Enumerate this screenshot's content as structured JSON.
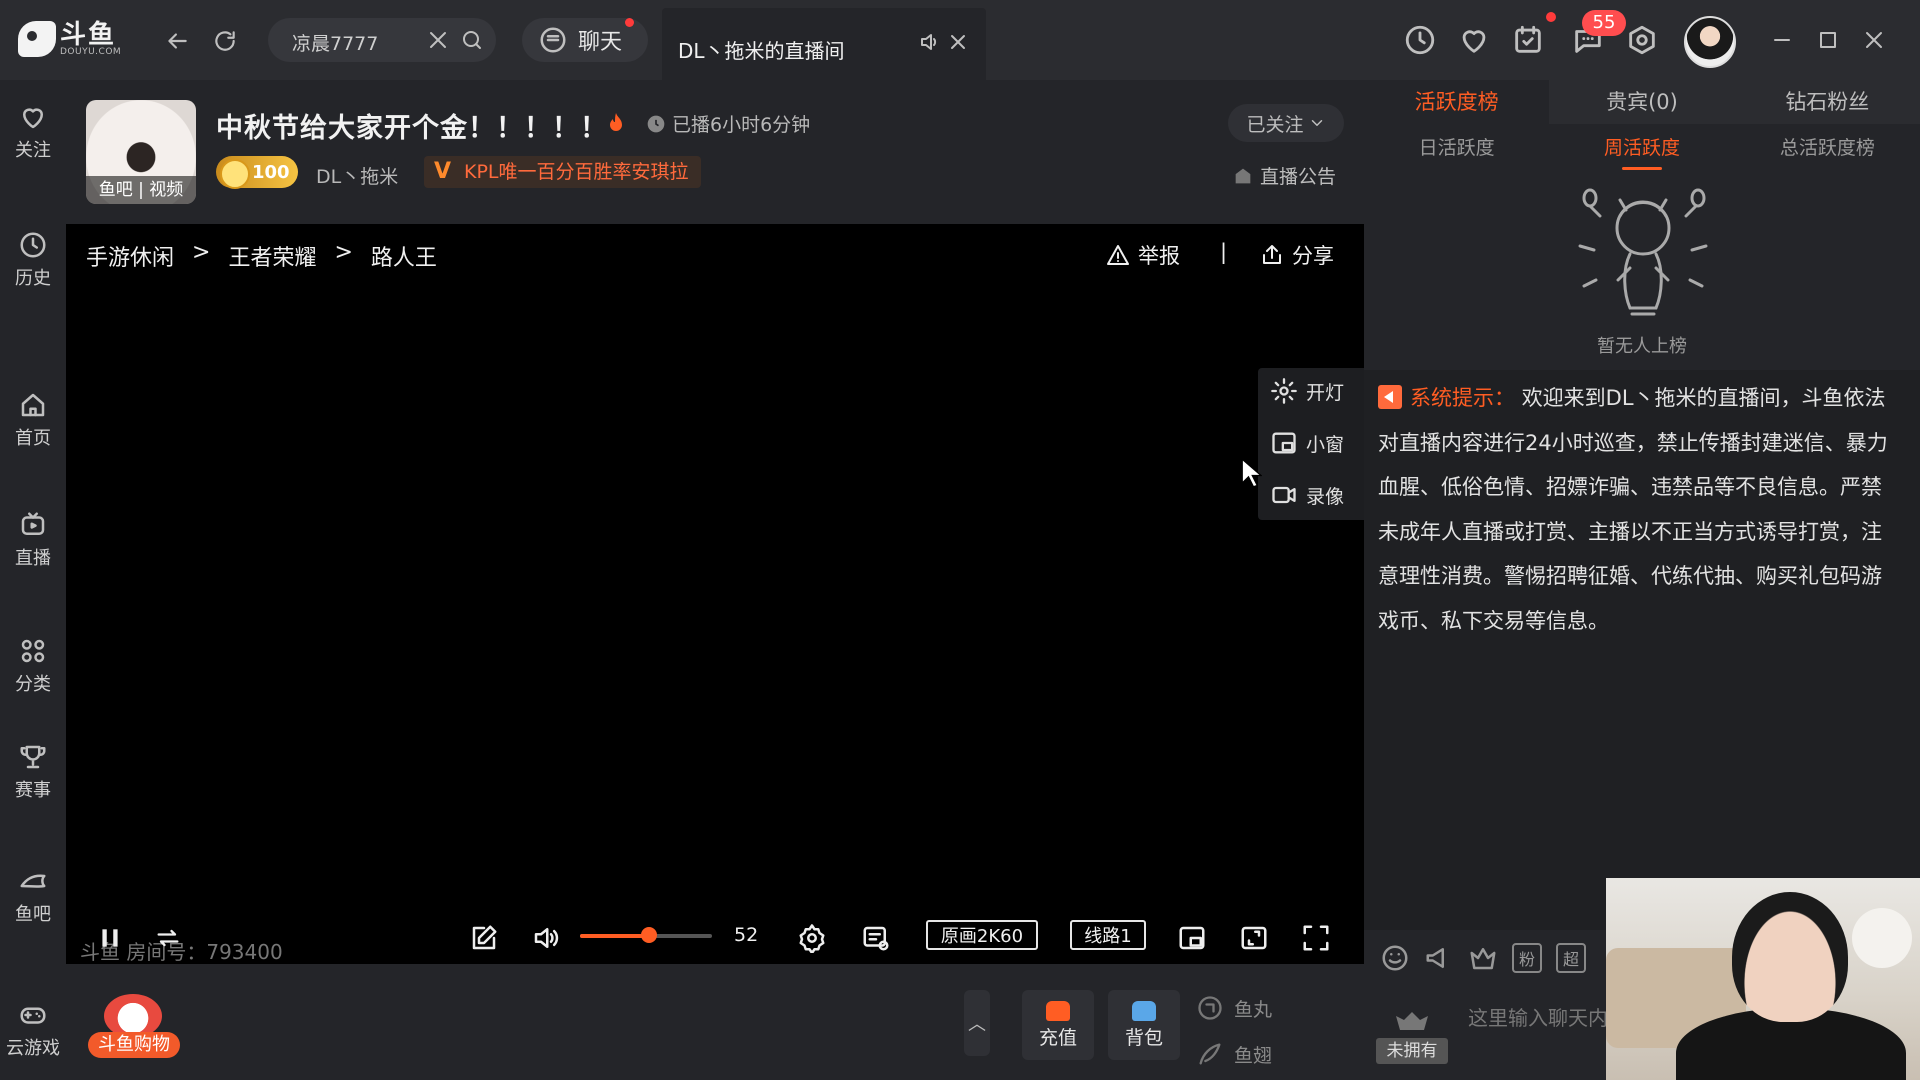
{
  "app": {
    "logo_text": "斗鱼",
    "logo_sub": "DOUYU.COM"
  },
  "topbar": {
    "search_value": "凉晨7777",
    "chat_tab_label": "聊天",
    "room_tab_label": "DL丶拖米的直播间",
    "message_badge": "55"
  },
  "sidebar": {
    "items": [
      {
        "label": "关注",
        "icon": "heart-icon"
      },
      {
        "label": "历史",
        "icon": "clock-icon"
      },
      {
        "label": "首页",
        "icon": "home-icon"
      },
      {
        "label": "直播",
        "icon": "tv-icon"
      },
      {
        "label": "分类",
        "icon": "grid-icon"
      },
      {
        "label": "赛事",
        "icon": "trophy-icon"
      },
      {
        "label": "鱼吧",
        "icon": "fish-icon"
      },
      {
        "label": "云游戏",
        "icon": "gamepad-icon"
      }
    ]
  },
  "anchor": {
    "avatar_caption": "鱼吧 | 视频",
    "room_title": "中秋节给大家开个金！！！！！",
    "live_duration": "已播6小时6分钟",
    "level": "100",
    "name": "DL丶拖米",
    "tag": "KPL唯一百分百胜率安琪拉",
    "follow_label": "已关注",
    "notice_label": "直播公告"
  },
  "player": {
    "breadcrumb": [
      "手游休闲",
      ">",
      "王者荣耀",
      ">",
      "路人王"
    ],
    "report_label": "举报",
    "separator": "|",
    "share_label": "分享",
    "tools": [
      {
        "label": "开灯",
        "icon": "gear-icon"
      },
      {
        "label": "小窗",
        "icon": "mini-window-icon"
      },
      {
        "label": "录像",
        "icon": "record-icon"
      }
    ],
    "room_id_text": "斗鱼 房间号：793400",
    "volume": 52,
    "volume_text": "52",
    "quality_label": "原画2K60",
    "line_label": "线路1"
  },
  "bottombar": {
    "shop_label": "斗鱼购物",
    "recharge_label": "充值",
    "backpack_label": "背包",
    "fish_ball_label": "鱼丸",
    "fish_wing_label": "鱼翅"
  },
  "rank": {
    "tabs": [
      "活跃度榜",
      "贵宾(0)",
      "钻石粉丝"
    ],
    "sub_tabs": [
      "日活跃度",
      "周活跃度",
      "总活跃度榜"
    ],
    "empty_text": "暂无人上榜"
  },
  "chat": {
    "system_tag": "系统提示：",
    "system_message": "欢迎来到DL丶拖米的直播间，斗鱼依法对直播内容进行24小时巡查，禁止传播封建迷信、暴力血腥、低俗色情、招嫖诈骗、违禁品等不良信息。严禁未成年人直播或打赏、主播以不正当方式诱导打赏，注意理性消费。警惕招聘征婚、代练代抽、购买礼包码游戏币、私下交易等信息。",
    "tool_fan": "粉",
    "tool_super": "超",
    "fan_badge_label": "未拥有",
    "input_placeholder": "这里输入聊天内容"
  },
  "colors": {
    "accent": "#ff5d23",
    "badge_red": "#ff4d4f",
    "bg": "#242529"
  }
}
